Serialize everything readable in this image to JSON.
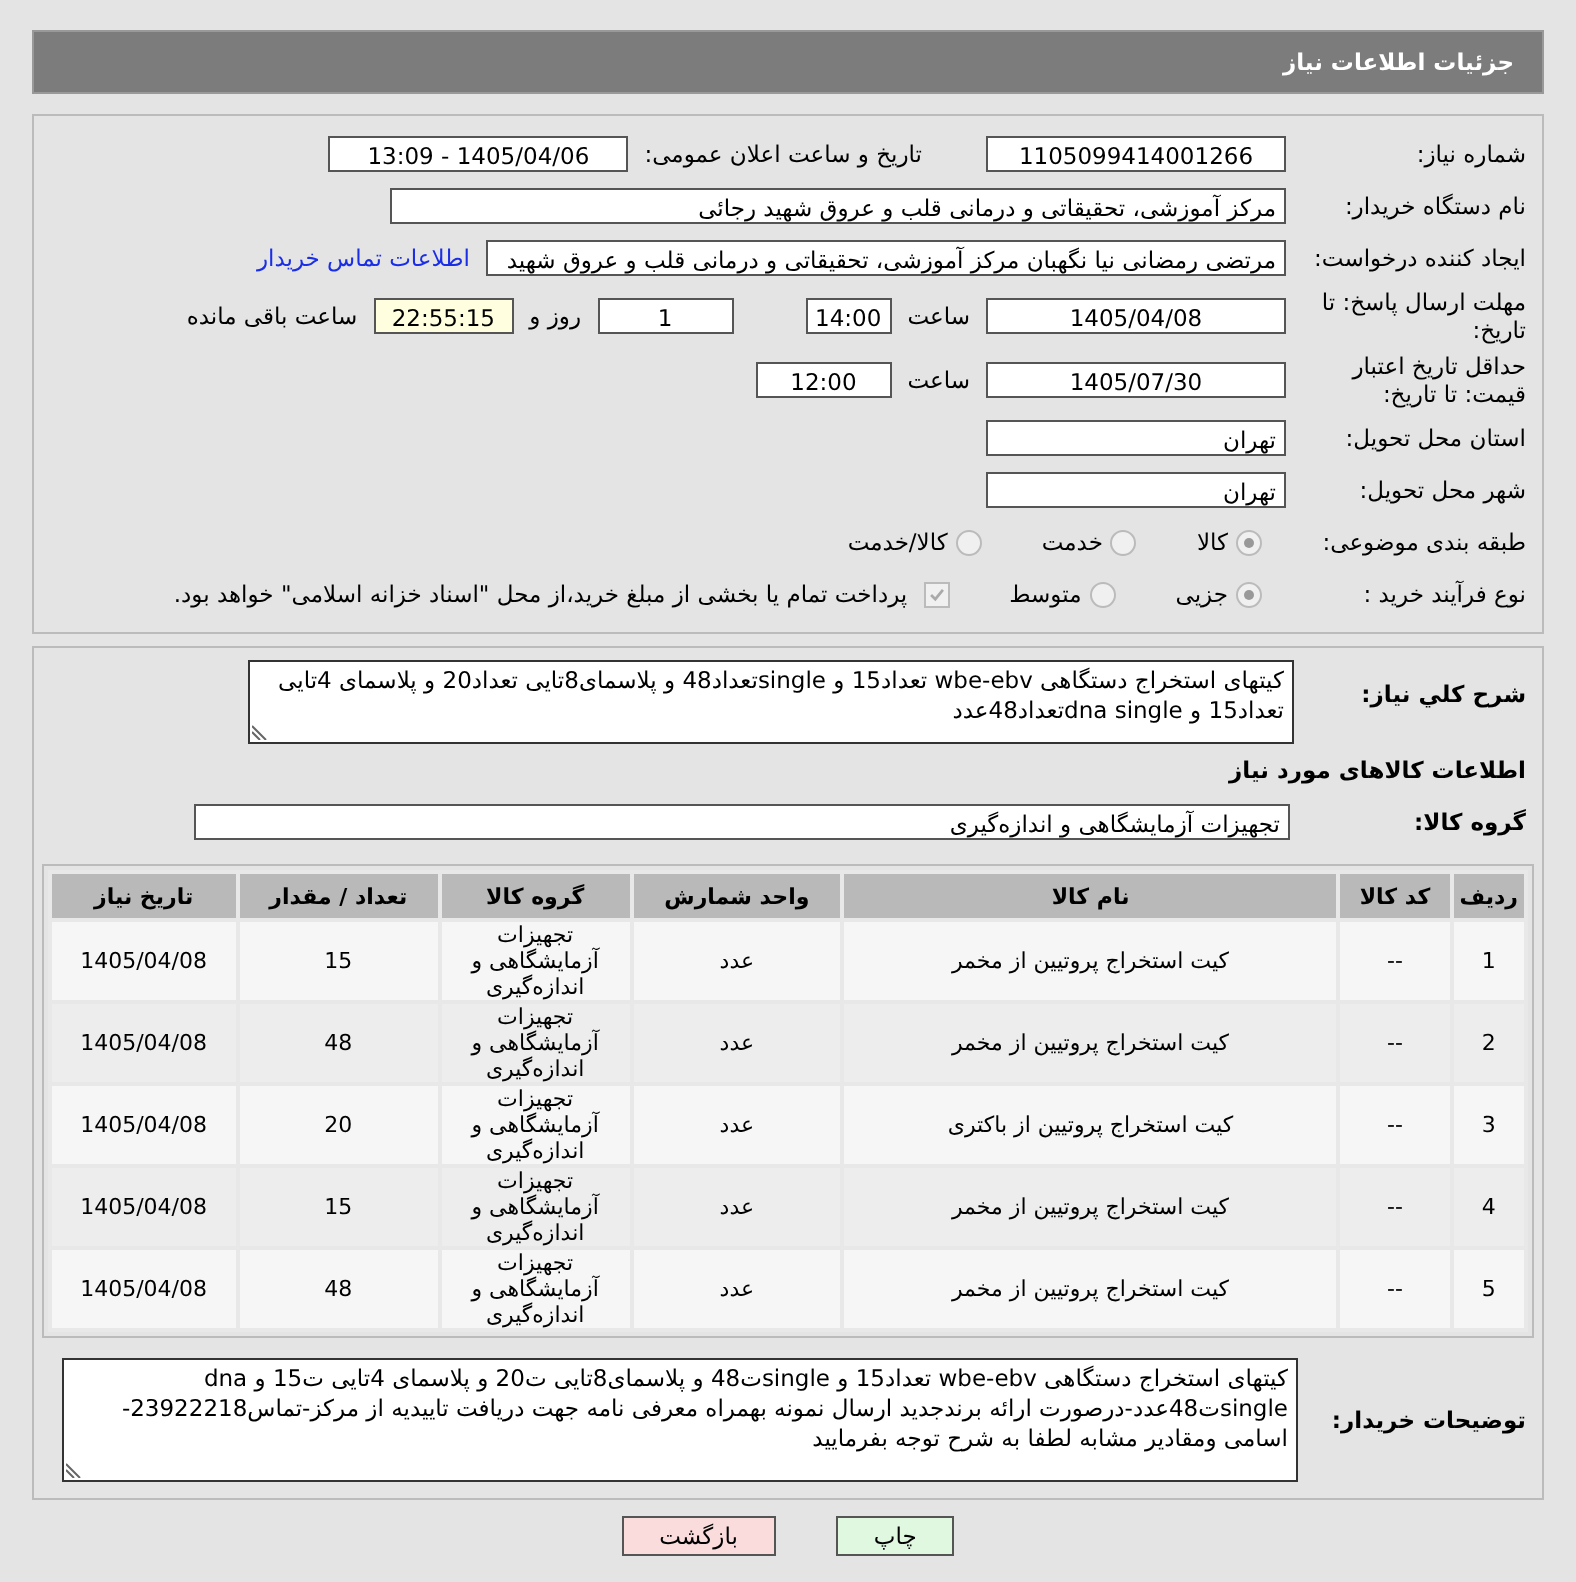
{
  "page_title": "جزئیات اطلاعات نیاز",
  "need_number": {
    "label": "شماره نیاز:",
    "value": "1105099414001266"
  },
  "announce": {
    "label": "تاریخ و ساعت اعلان عمومی:",
    "value": "1405/04/06 - 13:09"
  },
  "buyer_org": {
    "label": "نام دستگاه خریدار:",
    "value": "مرکز آموزشی، تحقیقاتی و درمانی قلب و عروق شهید رجائی"
  },
  "creator": {
    "label": "ایجاد کننده درخواست:",
    "value": "مرتضی رمضانی نیا نگهبان مرکز آموزشی، تحقیقاتی و درمانی قلب و عروق شهید",
    "link": "اطلاعات تماس خریدار"
  },
  "deadline": {
    "label": "مهلت ارسال پاسخ: تا تاریخ:",
    "date": "1405/04/08",
    "time_label": "ساعت",
    "time": "14:00",
    "days": "1",
    "days_label": "روز و",
    "remaining": "22:55:15",
    "remaining_label": "ساعت باقی مانده"
  },
  "validity": {
    "label": "حداقل تاریخ اعتبار قیمت: تا تاریخ:",
    "date": "1405/07/30",
    "time_label": "ساعت",
    "time": "12:00"
  },
  "province": {
    "label": "استان محل تحویل:",
    "value": "تهران"
  },
  "city": {
    "label": "شهر محل تحویل:",
    "value": "تهران"
  },
  "category": {
    "label": "طبقه بندی موضوعی:",
    "options": [
      {
        "label": "کالا",
        "selected": true
      },
      {
        "label": "خدمت",
        "selected": false
      },
      {
        "label": "کالا/خدمت",
        "selected": false
      }
    ]
  },
  "process": {
    "label": "نوع فرآیند خرید :",
    "options": [
      {
        "label": "جزیی",
        "selected": true
      },
      {
        "label": "متوسط",
        "selected": false
      }
    ],
    "treasury": {
      "label": "پرداخت تمام یا بخشی از مبلغ خرید،از محل \"اسناد خزانه اسلامی\" خواهد بود.",
      "checked": true
    }
  },
  "description": {
    "label": "شرح کلي نياز:",
    "value": "کیتهای استخراج دستگاهی wbe-ebv تعداد15 و singleتعداد48 و پلاسمای8تایی تعداد20 و پلاسمای 4تایی تعداد15 و dna singleتعداد48عدد"
  },
  "goods_heading": "اطلاعات کالاهای مورد نیاز",
  "goods_group": {
    "label": "گروه کالا:",
    "value": "تجهیزات آزمایشگاهی و اندازه‌گیری"
  },
  "table": {
    "columns": [
      "ردیف",
      "کد کالا",
      "نام کالا",
      "واحد شمارش",
      "گروه کالا",
      "تعداد / مقدار",
      "تاریخ نیاز"
    ],
    "rows": [
      [
        "1",
        "--",
        "کیت استخراج پروتیین از مخمر",
        "عدد",
        "تجهیزات آزمایشگاهی و اندازه‌گیری",
        "15",
        "1405/04/08"
      ],
      [
        "2",
        "--",
        "کیت استخراج پروتیین از مخمر",
        "عدد",
        "تجهیزات آزمایشگاهی و اندازه‌گیری",
        "48",
        "1405/04/08"
      ],
      [
        "3",
        "--",
        "کیت استخراج پروتیین از باکتری",
        "عدد",
        "تجهیزات آزمایشگاهی و اندازه‌گیری",
        "20",
        "1405/04/08"
      ],
      [
        "4",
        "--",
        "کیت استخراج پروتیین از مخمر",
        "عدد",
        "تجهیزات آزمایشگاهی و اندازه‌گیری",
        "15",
        "1405/04/08"
      ],
      [
        "5",
        "--",
        "کیت استخراج پروتیین از مخمر",
        "عدد",
        "تجهیزات آزمایشگاهی و اندازه‌گیری",
        "48",
        "1405/04/08"
      ]
    ]
  },
  "buyer_notes": {
    "label": "توضیحات خریدار:",
    "value": "کیتهای استخراج دستگاهی wbe-ebv تعداد15 و singleت48 و پلاسمای8تایی ت20 و پلاسمای 4تایی ت15 و dna singleت48عدد-درصورت ارائه برندجدید ارسال نمونه بهمراه معرفی نامه جهت دریافت تاییدیه از مرکز-تماس23922218-اسامی ومقادیر مشابه لطفا به شرح توجه بفرمایید"
  },
  "buttons": [
    {
      "label": "چاپ",
      "kind": "print"
    },
    {
      "label": "بازگشت",
      "kind": "back"
    }
  ]
}
